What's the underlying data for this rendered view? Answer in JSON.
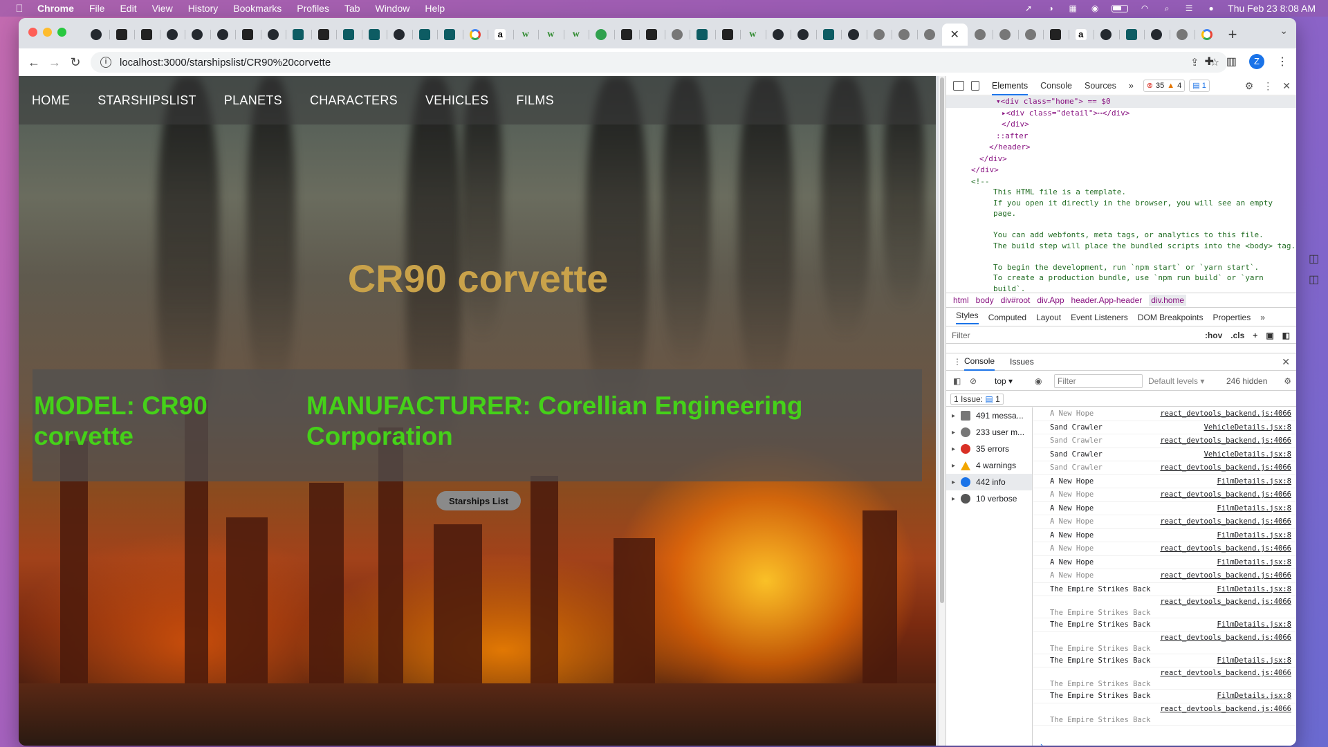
{
  "menubar": {
    "app": "Chrome",
    "items": [
      "File",
      "Edit",
      "View",
      "History",
      "Bookmarks",
      "Profiles",
      "Tab",
      "Window",
      "Help"
    ],
    "clock": "Thu Feb 23  8:08 AM"
  },
  "browser": {
    "tab_favicons": [
      "github",
      "dark",
      "dark",
      "github",
      "github",
      "github",
      "dark",
      "github",
      "teal",
      "dark",
      "green",
      "green",
      "github",
      "teal",
      "teal",
      "google",
      "amazon",
      "w",
      "w",
      "w",
      "green-circle",
      "dark",
      "dark",
      "grey",
      "teal",
      "dark",
      "w",
      "github",
      "github",
      "teal",
      "github",
      "grey",
      "grey",
      "grey",
      "active",
      "grey",
      "grey",
      "grey",
      "dark",
      "amazon",
      "github",
      "teal",
      "github",
      "grey",
      "google"
    ],
    "active_tab_close": "✕",
    "new_tab": "+",
    "url": "localhost:3000/starshipslist/CR90%20corvette",
    "profile_initial": "Z"
  },
  "site": {
    "nav": [
      "HOME",
      "STARSHIPSLIST",
      "PLANETS",
      "CHARACTERS",
      "VEHICLES",
      "FILMS"
    ],
    "title": "CR90 corvette",
    "model": "MODEL: CR90 corvette",
    "manufacturer": "MANUFACTURER: Corellian Engineering Corporation",
    "back_button": "Starships List"
  },
  "devtools": {
    "tabs": [
      "Elements",
      "Console",
      "Sources"
    ],
    "error_count": "35",
    "warning_count": "4",
    "issue_count": "1",
    "elements_lines": [
      {
        "text": "▾<div class=\"home\"> == $0",
        "sel": true,
        "indent": 72
      },
      {
        "text": "▸<div class=\"detail\">⋯</div>",
        "sel": false,
        "indent": 80
      },
      {
        "text": "</div>",
        "sel": false,
        "indent": 80
      },
      {
        "text": "::after",
        "sel": false,
        "indent": 72
      },
      {
        "text": "</header>",
        "sel": false,
        "indent": 62
      },
      {
        "text": "</div>",
        "sel": false,
        "indent": 48
      },
      {
        "text": "</div>",
        "sel": false,
        "indent": 36
      }
    ],
    "comment_open": "<!--",
    "comment_lines": [
      "This HTML file is a template.",
      "If you open it directly in the browser, you will see an empty page.",
      "",
      "You can add webfonts, meta tags, or analytics to this file.",
      "The build step will place the bundled scripts into the <body> tag.",
      "",
      "To begin the development, run `npm start` or `yarn start`.",
      "To create a production bundle, use `npm run build` or `yarn build`."
    ],
    "breadcrumbs": [
      "html",
      "body",
      "div#root",
      "div.App",
      "header.App-header",
      "div.home"
    ],
    "styles_tabs": [
      "Styles",
      "Computed",
      "Layout",
      "Event Listeners",
      "DOM Breakpoints",
      "Properties"
    ],
    "styles_filter_placeholder": "Filter",
    "styles_filter_opts": [
      ":hov",
      ".cls",
      "+"
    ],
    "drawer_tabs": [
      "Console",
      "Issues"
    ],
    "console": {
      "context": "top ▾",
      "filter_placeholder": "Filter",
      "levels": "Default levels ▾",
      "hidden": "246 hidden",
      "issue_bar_label": "1 Issue:",
      "issue_bar_count": "1",
      "sidebar": [
        {
          "label": "491 messa...",
          "icon": "list"
        },
        {
          "label": "233 user m...",
          "icon": "user"
        },
        {
          "label": "35 errors",
          "icon": "err"
        },
        {
          "label": "4 warnings",
          "icon": "warn"
        },
        {
          "label": "442 info",
          "icon": "info"
        },
        {
          "label": "10 verbose",
          "icon": "verb"
        }
      ],
      "log": [
        {
          "msg": "A New Hope",
          "src": "react_devtools_backend.js:4066",
          "dim": true
        },
        {
          "msg": "Sand Crawler",
          "src": "VehicleDetails.jsx:8",
          "dim": false
        },
        {
          "msg": "Sand Crawler",
          "src": "react_devtools_backend.js:4066",
          "dim": true
        },
        {
          "msg": "Sand Crawler",
          "src": "VehicleDetails.jsx:8",
          "dim": false
        },
        {
          "msg": "Sand Crawler",
          "src": "react_devtools_backend.js:4066",
          "dim": true
        },
        {
          "msg": "A New Hope",
          "src": "FilmDetails.jsx:8",
          "dim": false
        },
        {
          "msg": "A New Hope",
          "src": "react_devtools_backend.js:4066",
          "dim": true
        },
        {
          "msg": "A New Hope",
          "src": "FilmDetails.jsx:8",
          "dim": false
        },
        {
          "msg": "A New Hope",
          "src": "react_devtools_backend.js:4066",
          "dim": true
        },
        {
          "msg": "A New Hope",
          "src": "FilmDetails.jsx:8",
          "dim": false
        },
        {
          "msg": "A New Hope",
          "src": "react_devtools_backend.js:4066",
          "dim": true
        },
        {
          "msg": "A New Hope",
          "src": "FilmDetails.jsx:8",
          "dim": false
        },
        {
          "msg": "A New Hope",
          "src": "react_devtools_backend.js:4066",
          "dim": true
        },
        {
          "msg": "The Empire Strikes Back",
          "src": "FilmDetails.jsx:8",
          "dim": false
        },
        {
          "msg": "The Empire Strikes Back",
          "src": "react_devtools_backend.js:4066",
          "dim": true,
          "two": true
        },
        {
          "msg": "The Empire Strikes Back",
          "src": "FilmDetails.jsx:8",
          "dim": false
        },
        {
          "msg": "The Empire Strikes Back",
          "src": "react_devtools_backend.js:4066",
          "dim": true,
          "two": true
        },
        {
          "msg": "The Empire Strikes Back",
          "src": "FilmDetails.jsx:8",
          "dim": false
        },
        {
          "msg": "The Empire Strikes Back",
          "src": "react_devtools_backend.js:4066",
          "dim": true,
          "two": true
        },
        {
          "msg": "The Empire Strikes Back",
          "src": "FilmDetails.jsx:8",
          "dim": false
        },
        {
          "msg": "The Empire Strikes Back",
          "src": "react_devtools_backend.js:4066",
          "dim": true,
          "two": true
        }
      ],
      "prompt": "›"
    }
  },
  "colors": {
    "title": "#c9a24a",
    "details_text": "#45d119",
    "accent": "#1a73e8"
  }
}
